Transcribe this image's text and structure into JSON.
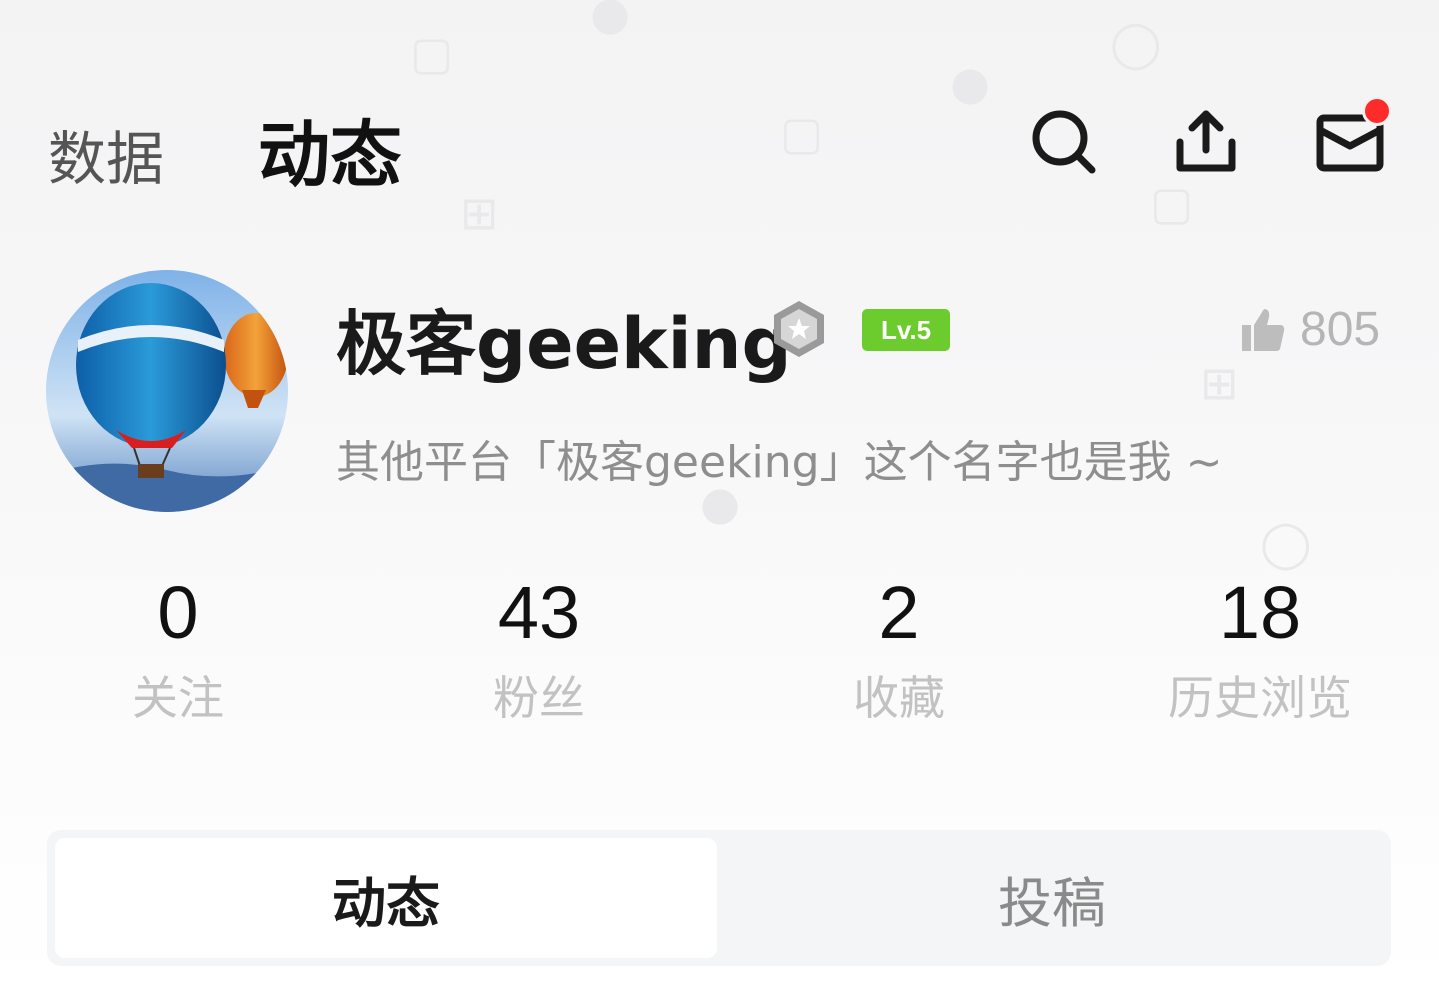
{
  "header": {
    "tabs": [
      {
        "label": "数据",
        "active": false
      },
      {
        "label": "动态",
        "active": true
      }
    ],
    "actions": {
      "search_icon": "search-icon",
      "share_icon": "share-icon",
      "mail_icon": "mail-icon",
      "mail_has_notification": true
    }
  },
  "profile": {
    "username": "极客geeking",
    "level_badge": "Lv.5",
    "likes_count": "805",
    "bio": "其他平台「极客geeking」这个名字也是我 ~"
  },
  "stats": [
    {
      "value": "0",
      "label": "关注"
    },
    {
      "value": "43",
      "label": "粉丝"
    },
    {
      "value": "2",
      "label": "收藏"
    },
    {
      "value": "18",
      "label": "历史浏览"
    }
  ],
  "content_tabs": [
    {
      "label": "动态",
      "active": true
    },
    {
      "label": "投稿",
      "active": false
    }
  ],
  "colors": {
    "level_badge_bg": "#6ccb2d",
    "notification_dot": "#ff2a2a"
  }
}
